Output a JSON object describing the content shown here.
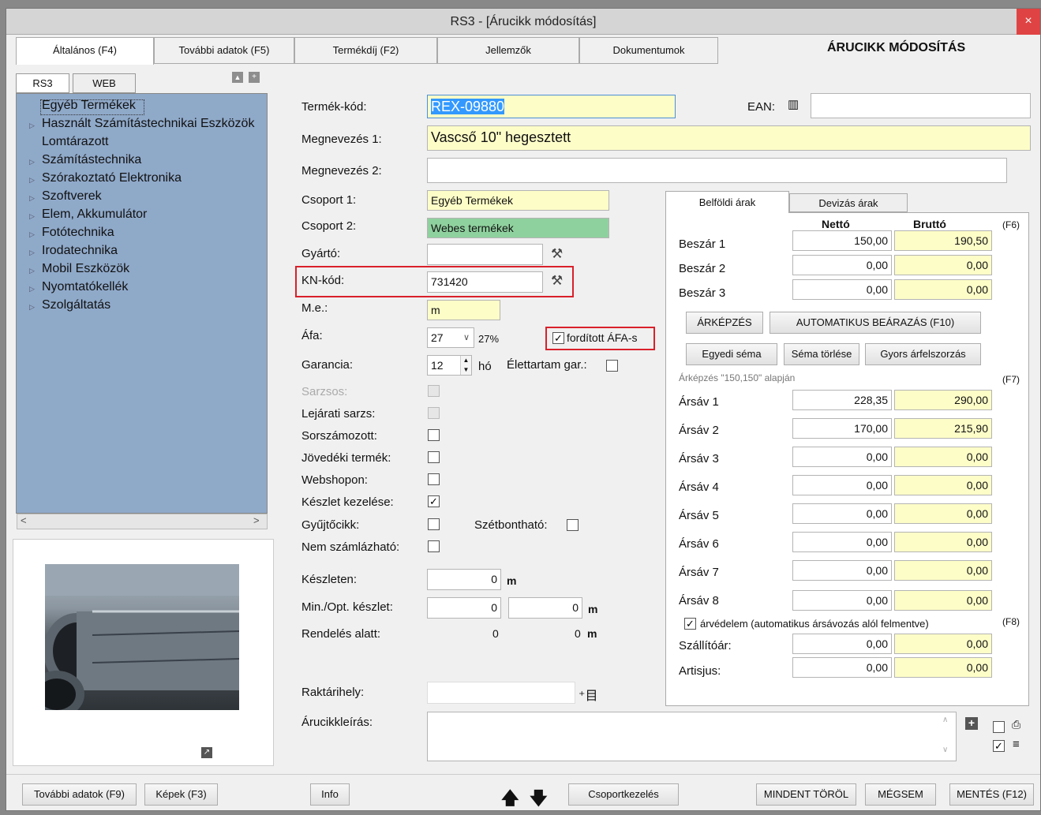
{
  "window": {
    "title": "RS3 - [Árucikk módosítás]",
    "close_glyph": "×"
  },
  "tabs": [
    "Általános (F4)",
    "További adatok (F5)",
    "Termékdíj (F2)",
    "Jellemzők",
    "Dokumentumok"
  ],
  "heading": "ÁRUCIKK MÓDOSÍTÁS",
  "tree": {
    "tabs": [
      "RS3",
      "WEB"
    ],
    "items": [
      "Egyéb Termékek",
      "Használt Számítástechnikai Eszközök",
      "Lomtárazott",
      "Számítástechnika",
      "Szórakoztató Elektronika",
      "Szoftverek",
      "Elem, Akkumulátor",
      "Fotótechnika",
      "Irodatechnika",
      "Mobil Eszközök",
      "Nyomtatókellék",
      "Szolgáltatás"
    ]
  },
  "form": {
    "termek_kod_label": "Termék-kód:",
    "termek_kod": "REX-09880",
    "ean_label": "EAN:",
    "ean": "",
    "megnevezes1_label": "Megnevezés 1:",
    "megnevezes1": "Vascső 10\" hegesztett",
    "megnevezes2_label": "Megnevezés 2:",
    "megnevezes2": "",
    "csoport1_label": "Csoport 1:",
    "csoport1": "Egyéb Termékek",
    "csoport2_label": "Csoport 2:",
    "csoport2": "Webes termékek",
    "gyarto_label": "Gyártó:",
    "gyarto": "",
    "kn_label": "KN-kód:",
    "kn": "731420",
    "me_label": "M.e.:",
    "me": "m",
    "afa_label": "Áfa:",
    "afa": "27",
    "afa_pct": "27%",
    "forditott_label": "fordított ÁFA-s",
    "garancia_label": "Garancia:",
    "garancia": "12",
    "garancia_unit": "hó",
    "elettartam_label": "Élettartam gar.:",
    "sarzsos_label": "Sarzsos:",
    "lejarati_label": "Lejárati sarzs:",
    "sorszam_label": "Sorszámozott:",
    "jovedeki_label": "Jövedéki termék:",
    "webshop_label": "Webshopon:",
    "keszlet_kez_label": "Készlet kezelése:",
    "gyujto_label": "Gyűjtőcikk:",
    "szetbont_label": "Szétbontható:",
    "nemszamla_label": "Nem számlázható:",
    "keszleten_label": "Készleten:",
    "keszleten": "0",
    "unit": "m",
    "minopt_label": "Min./Opt. készlet:",
    "min": "0",
    "opt": "0",
    "rendeles_label": "Rendelés alatt:",
    "rendeles1": "0",
    "rendeles2": "0",
    "raktar_label": "Raktárihely:",
    "raktar": "",
    "leiras_label": "Árucikkleírás:",
    "leiras": ""
  },
  "prices": {
    "tabs": [
      "Belföldi árak",
      "Devizás árak"
    ],
    "netto_header": "Nettó",
    "brutto_header": "Bruttó",
    "f6": "(F6)",
    "f7": "(F7)",
    "f8": "(F8)",
    "beszar": [
      {
        "label": "Beszár 1",
        "netto": "150,00",
        "brutto": "190,50"
      },
      {
        "label": "Beszár 2",
        "netto": "0,00",
        "brutto": "0,00"
      },
      {
        "label": "Beszár 3",
        "netto": "0,00",
        "brutto": "0,00"
      }
    ],
    "btn_arkepzes": "ÁRKÉPZÉS",
    "btn_auto": "AUTOMATIKUS BEÁRAZÁS (F10)",
    "btn_egyedi": "Egyedi séma",
    "btn_sema_torl": "Séma törlése",
    "btn_gyors": "Gyors árfelszorzás",
    "arkepzes_note": "Árképzés \"150,150\" alapján",
    "arsav": [
      {
        "label": "Ársáv 1",
        "netto": "228,35",
        "brutto": "290,00"
      },
      {
        "label": "Ársáv 2",
        "netto": "170,00",
        "brutto": "215,90"
      },
      {
        "label": "Ársáv 3",
        "netto": "0,00",
        "brutto": "0,00"
      },
      {
        "label": "Ársáv 4",
        "netto": "0,00",
        "brutto": "0,00"
      },
      {
        "label": "Ársáv 5",
        "netto": "0,00",
        "brutto": "0,00"
      },
      {
        "label": "Ársáv 6",
        "netto": "0,00",
        "brutto": "0,00"
      },
      {
        "label": "Ársáv 7",
        "netto": "0,00",
        "brutto": "0,00"
      },
      {
        "label": "Ársáv 8",
        "netto": "0,00",
        "brutto": "0,00"
      }
    ],
    "arvedelem_label": "árvédelem (automatikus ársávozás alól felmentve)",
    "szallito_label": "Szállítóár:",
    "szallito_netto": "0,00",
    "szallito_brutto": "0,00",
    "artisjus_label": "Artisjus:",
    "artisjus_netto": "0,00",
    "artisjus_brutto": "0,00"
  },
  "bottom": {
    "tovabbi": "További adatok (F9)",
    "kepek": "Képek (F3)",
    "info": "Info",
    "csoport": "Csoportkezelés",
    "mindent": "MINDENT TÖRÖL",
    "megsem": "MÉGSEM",
    "mentes": "MENTÉS (F12)"
  },
  "colors": {
    "tree_bg": "#8fa9c9",
    "yellow_field": "#fdfdc8",
    "green_field": "#8fd19e",
    "highlight": "#d9202a"
  }
}
